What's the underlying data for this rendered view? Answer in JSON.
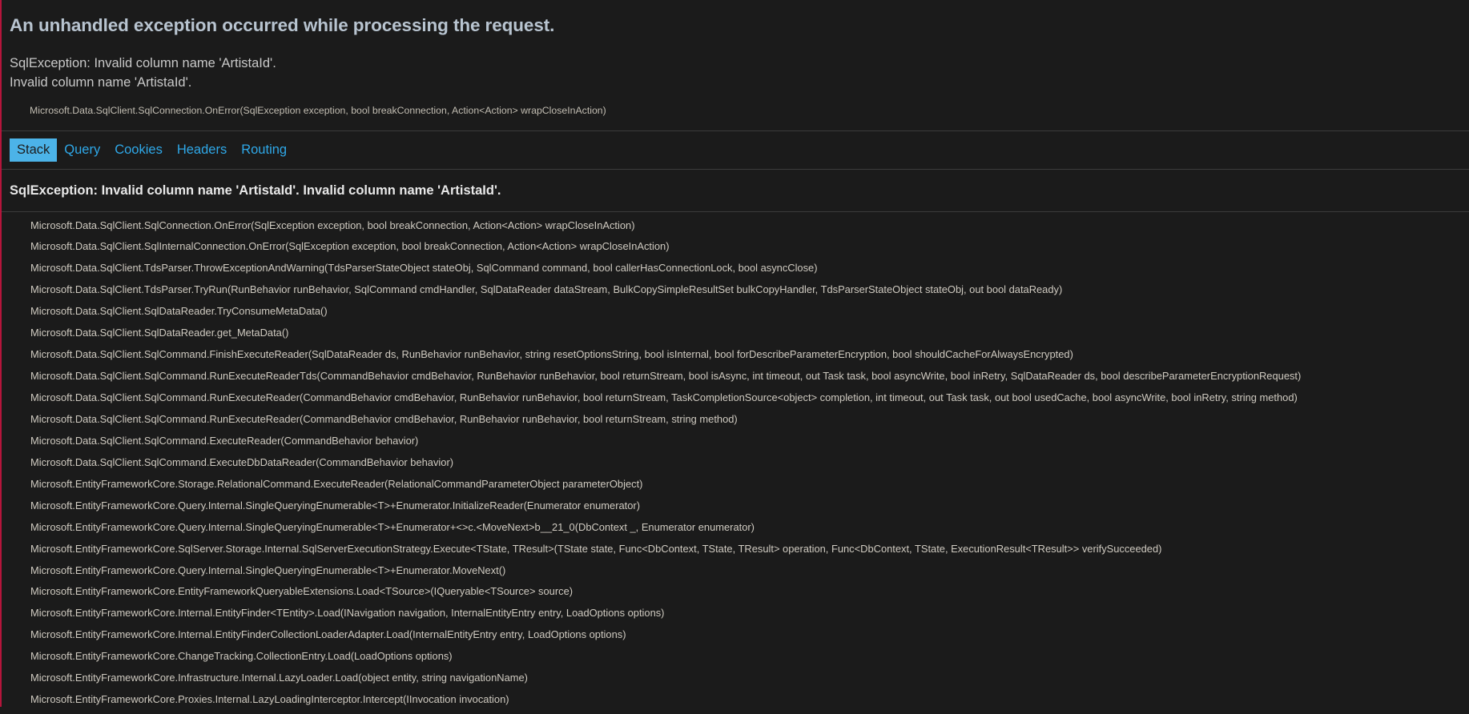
{
  "page": {
    "title": "An unhandled exception occurred while processing the request.",
    "accent_bar_color": "#b5153b",
    "background_color": "#1b1b1b",
    "active_tab_color": "#4cb3e8",
    "link_color": "#2fa8e8"
  },
  "summary": {
    "line1": "SqlException: Invalid column name 'ArtistaId'.",
    "line2": "Invalid column name 'ArtistaId'.",
    "frame_preview": "Microsoft.Data.SqlClient.SqlConnection.OnError(SqlException exception, bool breakConnection, Action<Action> wrapCloseInAction)"
  },
  "tabs": [
    {
      "label": "Stack",
      "active": true
    },
    {
      "label": "Query",
      "active": false
    },
    {
      "label": "Cookies",
      "active": false
    },
    {
      "label": "Headers",
      "active": false
    },
    {
      "label": "Routing",
      "active": false
    }
  ],
  "stack": {
    "heading": "SqlException: Invalid column name 'ArtistaId'. Invalid column name 'ArtistaId'.",
    "frames": [
      "Microsoft.Data.SqlClient.SqlConnection.OnError(SqlException exception, bool breakConnection, Action<Action> wrapCloseInAction)",
      "Microsoft.Data.SqlClient.SqlInternalConnection.OnError(SqlException exception, bool breakConnection, Action<Action> wrapCloseInAction)",
      "Microsoft.Data.SqlClient.TdsParser.ThrowExceptionAndWarning(TdsParserStateObject stateObj, SqlCommand command, bool callerHasConnectionLock, bool asyncClose)",
      "Microsoft.Data.SqlClient.TdsParser.TryRun(RunBehavior runBehavior, SqlCommand cmdHandler, SqlDataReader dataStream, BulkCopySimpleResultSet bulkCopyHandler, TdsParserStateObject stateObj, out bool dataReady)",
      "Microsoft.Data.SqlClient.SqlDataReader.TryConsumeMetaData()",
      "Microsoft.Data.SqlClient.SqlDataReader.get_MetaData()",
      "Microsoft.Data.SqlClient.SqlCommand.FinishExecuteReader(SqlDataReader ds, RunBehavior runBehavior, string resetOptionsString, bool isInternal, bool forDescribeParameterEncryption, bool shouldCacheForAlwaysEncrypted)",
      "Microsoft.Data.SqlClient.SqlCommand.RunExecuteReaderTds(CommandBehavior cmdBehavior, RunBehavior runBehavior, bool returnStream, bool isAsync, int timeout, out Task task, bool asyncWrite, bool inRetry, SqlDataReader ds, bool describeParameterEncryptionRequest)",
      "Microsoft.Data.SqlClient.SqlCommand.RunExecuteReader(CommandBehavior cmdBehavior, RunBehavior runBehavior, bool returnStream, TaskCompletionSource<object> completion, int timeout, out Task task, out bool usedCache, bool asyncWrite, bool inRetry, string method)",
      "Microsoft.Data.SqlClient.SqlCommand.RunExecuteReader(CommandBehavior cmdBehavior, RunBehavior runBehavior, bool returnStream, string method)",
      "Microsoft.Data.SqlClient.SqlCommand.ExecuteReader(CommandBehavior behavior)",
      "Microsoft.Data.SqlClient.SqlCommand.ExecuteDbDataReader(CommandBehavior behavior)",
      "Microsoft.EntityFrameworkCore.Storage.RelationalCommand.ExecuteReader(RelationalCommandParameterObject parameterObject)",
      "Microsoft.EntityFrameworkCore.Query.Internal.SingleQueryingEnumerable<T>+Enumerator.InitializeReader(Enumerator enumerator)",
      "Microsoft.EntityFrameworkCore.Query.Internal.SingleQueryingEnumerable<T>+Enumerator+<>c.<MoveNext>b__21_0(DbContext _, Enumerator enumerator)",
      "Microsoft.EntityFrameworkCore.SqlServer.Storage.Internal.SqlServerExecutionStrategy.Execute<TState, TResult>(TState state, Func<DbContext, TState, TResult> operation, Func<DbContext, TState, ExecutionResult<TResult>> verifySucceeded)",
      "Microsoft.EntityFrameworkCore.Query.Internal.SingleQueryingEnumerable<T>+Enumerator.MoveNext()",
      "Microsoft.EntityFrameworkCore.EntityFrameworkQueryableExtensions.Load<TSource>(IQueryable<TSource> source)",
      "Microsoft.EntityFrameworkCore.Internal.EntityFinder<TEntity>.Load(INavigation navigation, InternalEntityEntry entry, LoadOptions options)",
      "Microsoft.EntityFrameworkCore.Internal.EntityFinderCollectionLoaderAdapter.Load(InternalEntityEntry entry, LoadOptions options)",
      "Microsoft.EntityFrameworkCore.ChangeTracking.CollectionEntry.Load(LoadOptions options)",
      "Microsoft.EntityFrameworkCore.Infrastructure.Internal.LazyLoader.Load(object entity, string navigationName)",
      "Microsoft.EntityFrameworkCore.Proxies.Internal.LazyLoadingInterceptor.Intercept(IInvocation invocation)"
    ]
  }
}
